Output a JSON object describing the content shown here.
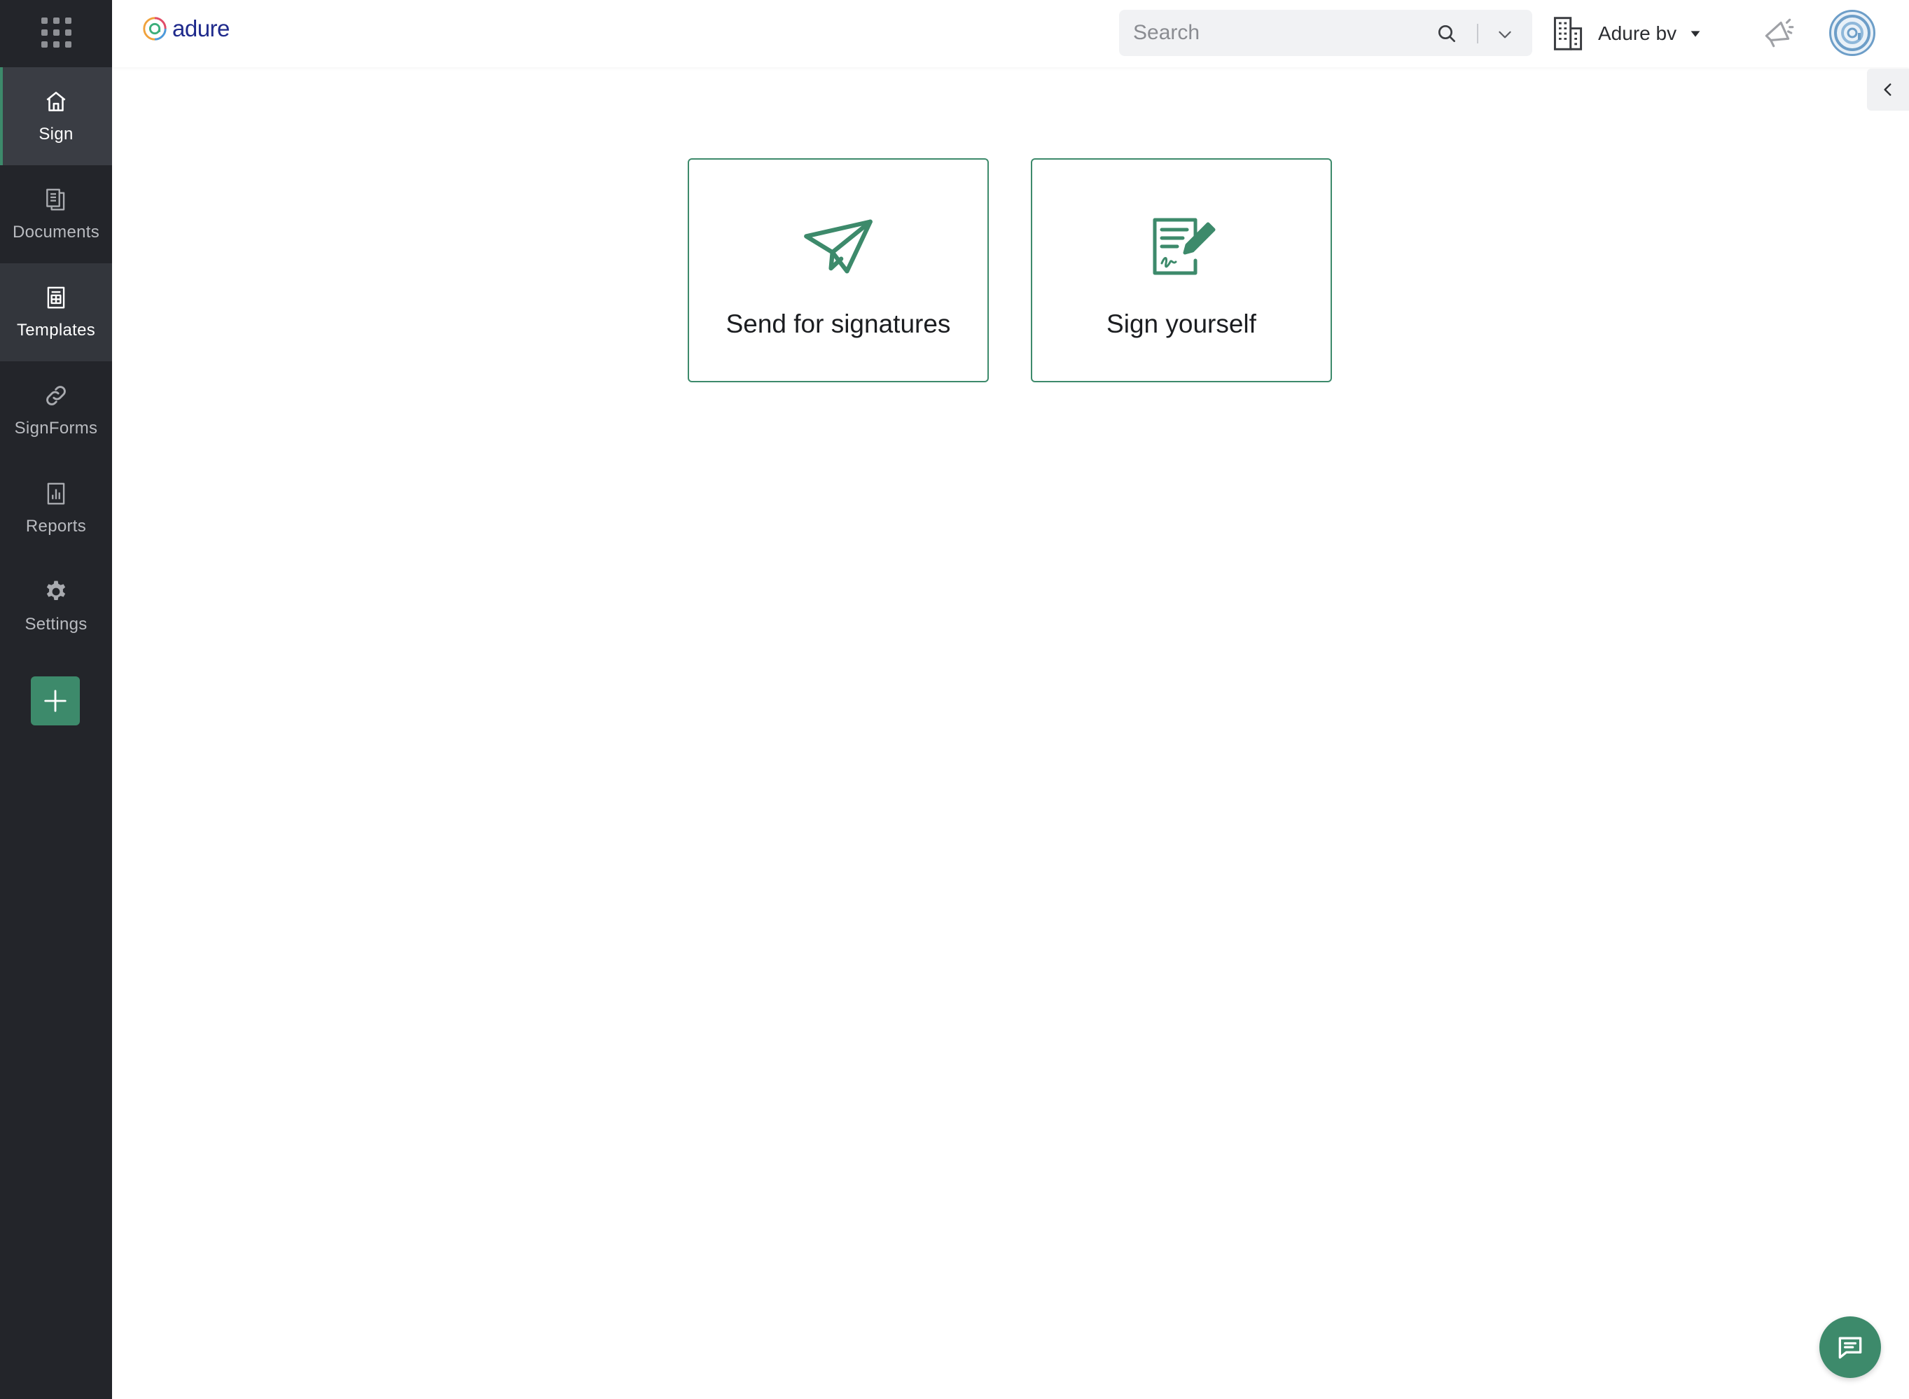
{
  "brand": {
    "name": "adure"
  },
  "colors": {
    "accent": "#3d8a6b",
    "sidebar_bg": "#23252a",
    "brand_text": "#1f2a8c"
  },
  "sidebar": {
    "apps_icon": "apps-grid-icon",
    "items": [
      {
        "label": "Sign",
        "icon": "home-icon",
        "state": "active"
      },
      {
        "label": "Documents",
        "icon": "documents-icon",
        "state": "normal"
      },
      {
        "label": "Templates",
        "icon": "templates-icon",
        "state": "hover"
      },
      {
        "label": "SignForms",
        "icon": "link-icon",
        "state": "normal"
      },
      {
        "label": "Reports",
        "icon": "reports-icon",
        "state": "normal"
      },
      {
        "label": "Settings",
        "icon": "gear-icon",
        "state": "normal"
      }
    ],
    "add_icon": "plus-icon"
  },
  "header": {
    "search": {
      "placeholder": "Search",
      "value": ""
    },
    "org": {
      "name": "Adure bv"
    }
  },
  "actions": {
    "send": {
      "label": "Send for signatures",
      "icon": "paper-plane-icon"
    },
    "sign": {
      "label": "Sign yourself",
      "icon": "sign-document-icon"
    }
  }
}
